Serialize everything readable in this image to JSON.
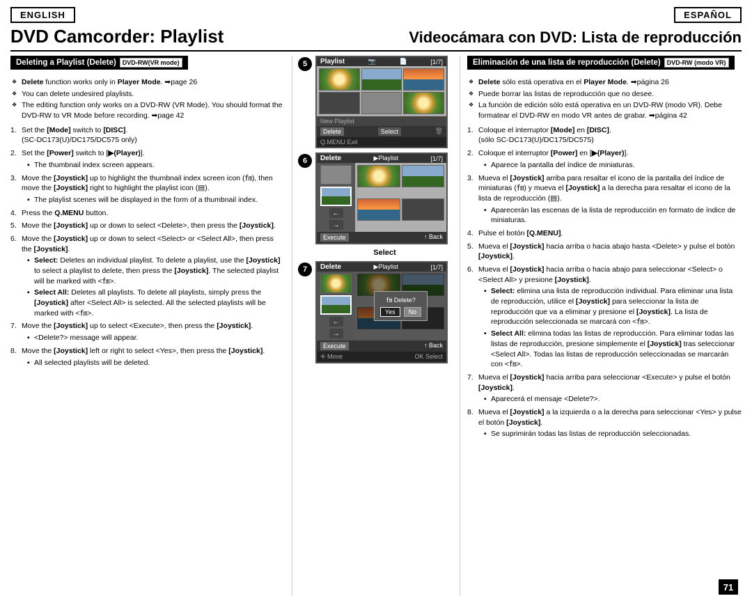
{
  "header": {
    "lang_en": "ENGLISH",
    "lang_es": "ESPAÑOL",
    "title_en": "DVD Camcorder: Playlist",
    "title_es": "Videocámara con DVD: Lista de reproducción"
  },
  "section_en": {
    "header": "Deleting a Playlist (Delete)",
    "dvd_badge": "DVD-RW(VR mode)",
    "notes": [
      "Delete function works only in Player Mode. ➡page 26",
      "You can delete undesired playlists.",
      "The editing function only works on a DVD-RW (VR Mode). You should format the DVD-RW to VR Mode before recording. ➡page 42"
    ],
    "steps": [
      {
        "num": "1.",
        "text": "Set the [Mode] switch to [DISC]. (SC-DC173(U)/DC175/DC575 only)"
      },
      {
        "num": "2.",
        "text": "Set the [Power] switch to [▶(Player)].",
        "sub": [
          "The thumbnail index screen appears."
        ]
      },
      {
        "num": "3.",
        "text": "Move the [Joystick] up to highlight the thumbnail index screen icon (㎙), then move the [Joystick] right to highlight the playlist icon (▤).",
        "sub": [
          "The playlist scenes will be displayed in the form of a thumbnail index."
        ]
      },
      {
        "num": "4.",
        "text": "Press the Q.MENU button."
      },
      {
        "num": "5.",
        "text": "Move the [Joystick] up or down to select <Delete>, then press the [Joystick]."
      },
      {
        "num": "6.",
        "text": "Move the [Joystick] up or down to select <Select> or <Select All>, then press the [Joystick].",
        "sub": [
          "Select: Deletes an individual playlist. To delete a playlist, use the [Joystick] to select a playlist to delete, then press the [Joystick]. The selected playlist will be marked with <㎙>.",
          "Select All: Deletes all playlists. To delete all playlists, simply press the [Joystick] after <Select All> is selected. All the selected playlists will be marked with <㎙>."
        ]
      },
      {
        "num": "7.",
        "text": "Move the [Joystick] up to select <Execute>, then press the [Joystick].",
        "sub": [
          "<Delete?> message will appear."
        ]
      },
      {
        "num": "8.",
        "text": "Move the [Joystick] left or right to select <Yes>, then press the [Joystick].",
        "sub": [
          "All selected playlists will be deleted."
        ]
      }
    ]
  },
  "section_es": {
    "header": "Eliminación de una lista de reproducción (Delete)",
    "dvd_badge": "DVD-RW (modo VR)",
    "notes": [
      "Delete sólo está operativa en el Player Mode. ➡página 26",
      "Puede borrar las listas de reproducción que no desee.",
      "La función de edición sólo está operativa en un DVD-RW (modo VR). Debe formatear el DVD-RW en modo VR antes de grabar. ➡página 42"
    ],
    "steps": [
      {
        "num": "1.",
        "text": "Coloque el interruptor [Mode] en [DISC]. (sólo SC-DC173(U)/DC175/DC575)"
      },
      {
        "num": "2.",
        "text": "Coloque el interruptor [Power] en [▶(Player)].",
        "sub": [
          "Aparece la pantalla del índice de miniaturas."
        ]
      },
      {
        "num": "3.",
        "text": "Mueva el [Joystick] arriba para resaltar el icono de la pantalla del índice de miniaturas (㎙) y mueva el [Joystick] a la derecha para resaltar el icono de la lista de reproducción (▤).",
        "sub": [
          "Aparecerán las escenas de la lista de reproducción en formato de índice de miniaturas."
        ]
      },
      {
        "num": "4.",
        "text": "Pulse el botón [Q.MENU]."
      },
      {
        "num": "5.",
        "text": "Mueva el [Joystick] hacia arriba o hacia abajo hasta <Delete> y pulse el botón [Joystick]."
      },
      {
        "num": "6.",
        "text": "Mueva el [Joystick] hacia arriba o hacia abajo para seleccionar <Select> o <Select All> y presione [Joystick].",
        "sub": [
          "Select: elimina una lista de reproducción individual. Para eliminar una lista de reproducción, utilice el [Joystick] para seleccionar la lista de reproducción que va a eliminar y presione el [Joystick]. La lista de reproducción seleccionada se marcará con <㎙>.",
          "Select All: elimina todas las listas de reproducción. Para eliminar todas las listas de reproducción, presione simplemente el [Joystick] tras seleccionar <Select All>. Todas las listas de reproducción seleccionadas se marcarán con <㎙>."
        ]
      },
      {
        "num": "7.",
        "text": "Mueva el [Joystick] hacia arriba para seleccionar <Execute> y pulse el botón [Joystick].",
        "sub": [
          "Aparecerá el mensaje <Delete?>."
        ]
      },
      {
        "num": "8.",
        "text": "Mueva el [Joystick] a la izquierda o a la derecha para seleccionar <Yes> y pulse el botón [Joystick].",
        "sub": [
          "Se suprimirán todas las listas de reproducción seleccionadas."
        ]
      }
    ]
  },
  "screens": {
    "step5_title": "Playlist",
    "step5_counter": "[1/7]",
    "step5_new_playlist": "New Playlist",
    "step5_delete": "Delete",
    "step5_select": "Select",
    "step5_exit": "Q.MENU Exit",
    "step6_title": "Delete",
    "step6_playlist": "▶Playlist",
    "step6_counter": "[1/7]",
    "step6_execute": "Execute",
    "step6_back": "↑ Back",
    "step7_title": "Delete",
    "step7_playlist": "▶Playlist",
    "step7_counter": "[1/7]",
    "step7_execute": "Execute",
    "step7_back": "↑ Back",
    "step7_dialog": "㎙ Delete?",
    "step7_yes": "Yes",
    "step7_no": "No",
    "step7_move": "✛ Move",
    "step7_ok_select": "OK Select",
    "select_label": "Select"
  },
  "page_number": "71"
}
